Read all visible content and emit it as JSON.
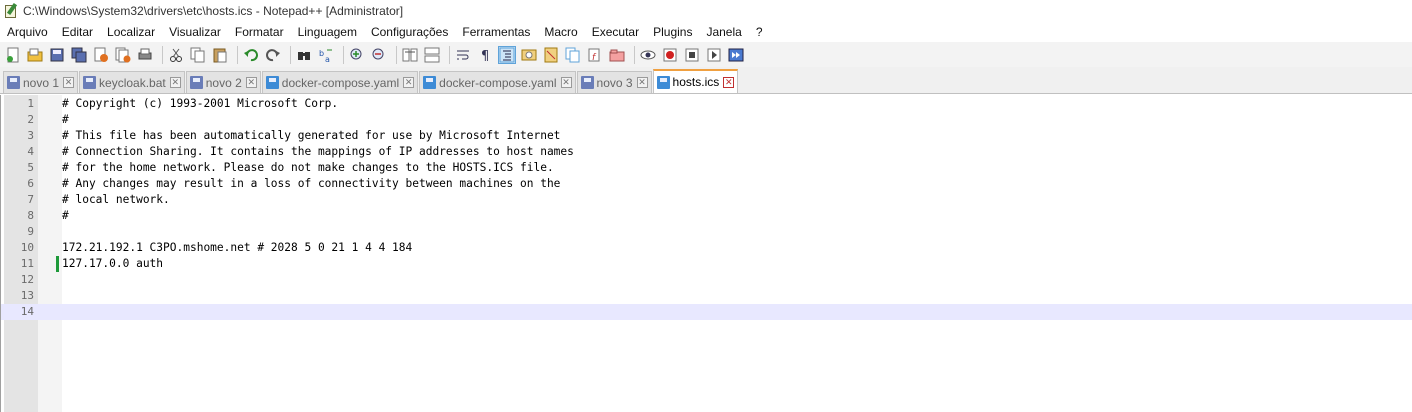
{
  "window": {
    "title": "C:\\Windows\\System32\\drivers\\etc\\hosts.ics - Notepad++ [Administrator]"
  },
  "menu": [
    "Arquivo",
    "Editar",
    "Localizar",
    "Visualizar",
    "Formatar",
    "Linguagem",
    "Configurações",
    "Ferramentas",
    "Macro",
    "Executar",
    "Plugins",
    "Janela",
    "?"
  ],
  "toolbar": {
    "icons": [
      "new-file-icon",
      "open-file-icon",
      "save-icon",
      "save-all-icon",
      "close-icon",
      "close-all-icon",
      "print-icon",
      "cut-icon",
      "copy-icon",
      "paste-icon",
      "undo-icon",
      "redo-icon",
      "find-icon",
      "replace-icon",
      "zoom-in-icon",
      "zoom-out-icon",
      "sync-vertical-icon",
      "sync-horizontal-icon",
      "word-wrap-icon",
      "show-all-chars-icon",
      "indent-guide-icon",
      "user-lang-icon",
      "doc-map-icon",
      "function-list-icon",
      "folder-workspace-icon",
      "monitoring-icon",
      "record-macro-icon",
      "stop-macro-icon",
      "play-macro-icon",
      "run-macro-multiple-icon",
      "save-macro-icon"
    ]
  },
  "tabs": [
    {
      "label": "novo 1",
      "active": false,
      "icon": "disk"
    },
    {
      "label": "keycloak.bat",
      "active": false,
      "icon": "disk"
    },
    {
      "label": "novo 2",
      "active": false,
      "icon": "disk"
    },
    {
      "label": "docker-compose.yaml",
      "active": false,
      "icon": "disk-blue"
    },
    {
      "label": "docker-compose.yaml",
      "active": false,
      "icon": "disk-blue"
    },
    {
      "label": "novo 3",
      "active": false,
      "icon": "disk"
    },
    {
      "label": "hosts.ics",
      "active": true,
      "icon": "disk-blue"
    }
  ],
  "editor": {
    "current_line": 14,
    "changed_lines": [
      11
    ],
    "lines": [
      {
        "n": "1",
        "text": "# Copyright (c) 1993-2001 Microsoft Corp."
      },
      {
        "n": "2",
        "text": "#"
      },
      {
        "n": "3",
        "text": "# This file has been automatically generated for use by Microsoft Internet"
      },
      {
        "n": "4",
        "text": "# Connection Sharing. It contains the mappings of IP addresses to host names"
      },
      {
        "n": "5",
        "text": "# for the home network. Please do not make changes to the HOSTS.ICS file."
      },
      {
        "n": "6",
        "text": "# Any changes may result in a loss of connectivity between machines on the"
      },
      {
        "n": "7",
        "text": "# local network."
      },
      {
        "n": "8",
        "text": "#"
      },
      {
        "n": "9",
        "text": ""
      },
      {
        "n": "10",
        "text": "172.21.192.1 C3PO.mshome.net # 2028 5 0 21 1 4 4 184"
      },
      {
        "n": "11",
        "text": "127.17.0.0 auth"
      },
      {
        "n": "12",
        "text": ""
      },
      {
        "n": "13",
        "text": ""
      },
      {
        "n": "14",
        "text": ""
      }
    ]
  }
}
